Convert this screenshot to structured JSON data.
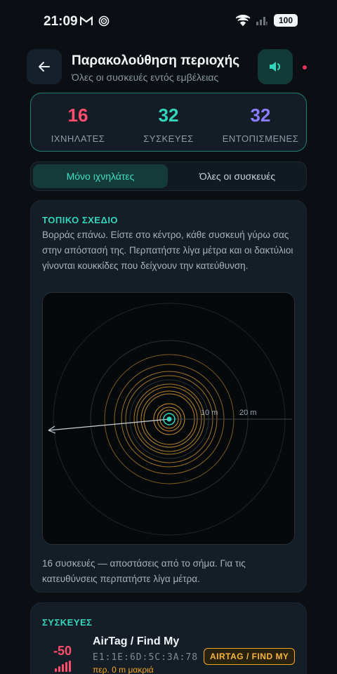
{
  "status_bar": {
    "time": "21:09",
    "battery": "100"
  },
  "header": {
    "title": "Παρακολούθηση περιοχής",
    "subtitle": "Όλες οι συσκευές εντός εμβέλειας"
  },
  "stats": [
    {
      "value": "16",
      "label": "ΙΧΝΗΛΑΤΕΣ",
      "color": "#ff4d6d"
    },
    {
      "value": "32",
      "label": "ΣΥΣΚΕΥΕΣ",
      "color": "#33d6bc"
    },
    {
      "value": "32",
      "label": "ΕΝΤΟΠΙΣΜΕΝΕΣ",
      "color": "#8b7bff"
    }
  ],
  "filter": {
    "active": "Μόνο ιχνηλάτες",
    "inactive": "Όλες οι συσκευές"
  },
  "map": {
    "section_title": "ΤΟΠΙΚΟ ΣΧΕΔΙΟ",
    "description": "Βορράς επάνω. Είστε στο κέντρο, κάθε συσκευή γύρω σας στην απόστασή της. Περπατήστε λίγα μέτρα και οι δακτύλιοι γίνονται κουκκίδες που δείχνουν την κατεύθυνση.",
    "ring_label_1": "10 m",
    "ring_label_2": "20 m",
    "footer": "16 συσκευές — αποστάσεις από το σήμα. Για τις κατευθύνσεις περπατήστε λίγα μέτρα."
  },
  "devices": {
    "section_title": "ΣΥΣΚΕΥΕΣ",
    "items": [
      {
        "rssi": "-50",
        "name": "AirTag / Find My",
        "mac": "E1:1E:6D:5C:3A:78",
        "distance": "περ. 0 m μακριά",
        "badge": "AIRTAG / FIND MY"
      }
    ]
  },
  "colors": {
    "accent": "#33d6bc",
    "tracker": "#ff4d6d",
    "warn": "#f5a623"
  }
}
